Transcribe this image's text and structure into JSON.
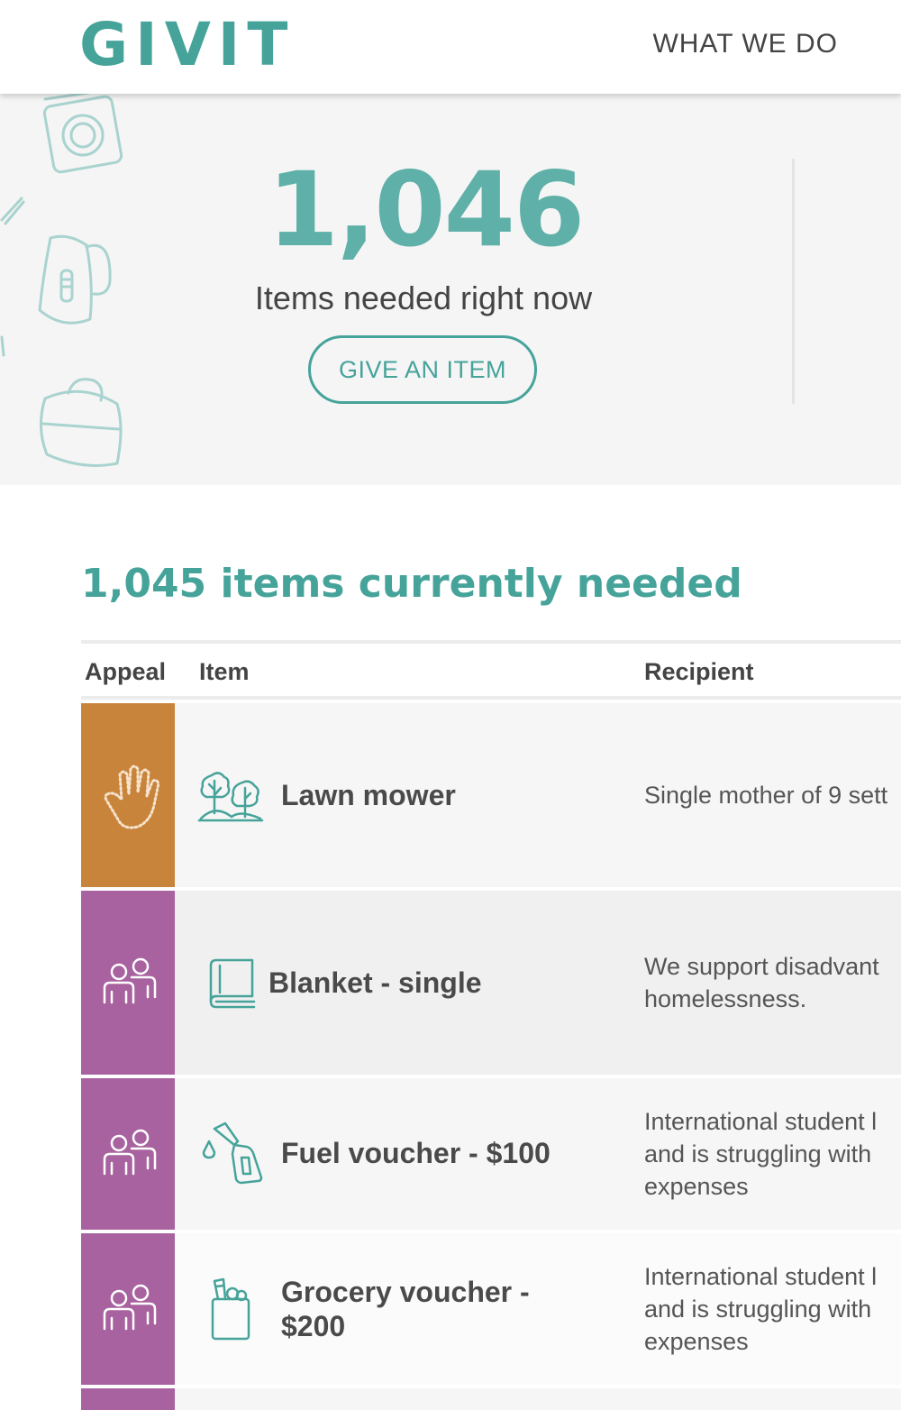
{
  "header": {
    "logo_text": "GIVIT",
    "nav_link": "WHAT WE DO",
    "brand_color": "#46a39a"
  },
  "hero": {
    "count": "1,046",
    "count_label": "Items needed right now",
    "button_label": "GIVE AN ITEM"
  },
  "list": {
    "heading": "1,045 items currently needed",
    "columns": {
      "appeal": "Appeal",
      "item": "Item",
      "recipient": "Recipient"
    },
    "rows": [
      {
        "appeal_icon": "hand-icon",
        "appeal_color": "#c8843b",
        "item_icon": "trees-icon",
        "item": "Lawn mower",
        "recipient_lines": [
          "Single mother of 9 sett"
        ]
      },
      {
        "appeal_icon": "people-icon",
        "appeal_color": "#a8629f",
        "item_icon": "blanket-icon",
        "item": "Blanket - single",
        "recipient_lines": [
          "We support disadvant",
          "homelessness."
        ]
      },
      {
        "appeal_icon": "people-icon",
        "appeal_color": "#a8629f",
        "item_icon": "fuel-icon",
        "item": "Fuel voucher - $100",
        "recipient_lines": [
          "International student l",
          "and is struggling with",
          "expenses"
        ]
      },
      {
        "appeal_icon": "people-icon",
        "appeal_color": "#a8629f",
        "item_icon": "grocery-bag-icon",
        "item_lines": [
          "Grocery voucher -",
          "$200"
        ],
        "recipient_lines": [
          "International student l",
          "and is struggling with",
          "expenses"
        ]
      }
    ]
  }
}
